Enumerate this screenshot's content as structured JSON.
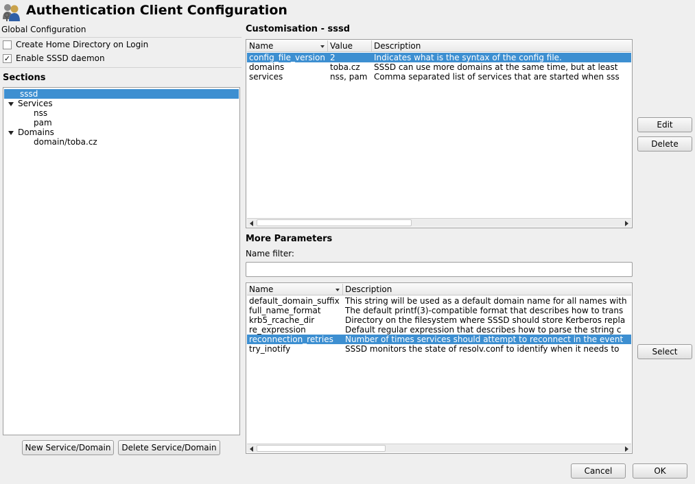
{
  "window": {
    "title": "Authentication Client Configuration",
    "icon": "users-keys-icon"
  },
  "global": {
    "label": "Global Configuration",
    "create_home": {
      "label": "Create Home Directory on Login",
      "checked": false
    },
    "enable_sssd": {
      "label": "Enable SSSD daemon",
      "checked": true,
      "check_glyph": "✓"
    }
  },
  "sections": {
    "label": "Sections",
    "tree": [
      {
        "label": "sssd",
        "selected": true
      },
      {
        "label": "Services",
        "expanded": true
      },
      {
        "label": "nss"
      },
      {
        "label": "pam"
      },
      {
        "label": "Domains",
        "expanded": true
      },
      {
        "label": "domain/toba.cz"
      }
    ],
    "new_button": "New Service/Domain",
    "delete_button": "Delete Service/Domain"
  },
  "customisation": {
    "label": "Customisation - sssd",
    "columns": [
      "Name",
      "Value",
      "Description"
    ],
    "rows": [
      {
        "name": "config_file_version",
        "value": "2",
        "description": "Indicates what is the syntax of the config file."
      },
      {
        "name": "domains",
        "value": "toba.cz",
        "description": "SSSD can use more domains at the same time, but at least"
      },
      {
        "name": "services",
        "value": "nss, pam",
        "description": "Comma separated list of services that are started when sss"
      }
    ],
    "edit_button": "Edit",
    "delete_button": "Delete"
  },
  "more_params": {
    "label": "More Parameters",
    "filter_label": "Name filter:",
    "filter_value": "",
    "columns": [
      "Name",
      "Description"
    ],
    "rows": [
      {
        "name": "default_domain_suffix",
        "description": "This string will be used as a default domain name for all names with"
      },
      {
        "name": "full_name_format",
        "description": "The default printf(3)-compatible format that describes how to trans"
      },
      {
        "name": "krb5_rcache_dir",
        "description": "Directory on the filesystem where SSSD should store Kerberos repla"
      },
      {
        "name": "re_expression",
        "description": "Default regular expression that describes how to parse the string c"
      },
      {
        "name": "reconnection_retries",
        "description": "Number of times services should attempt to reconnect in the event"
      },
      {
        "name": "try_inotify",
        "description": "SSSD monitors the state of resolv.conf to identify when it needs to"
      }
    ],
    "select_button": "Select"
  },
  "footer": {
    "cancel": "Cancel",
    "ok": "OK"
  },
  "colors": {
    "selection": "#3d8fd1",
    "background": "#efefef"
  }
}
